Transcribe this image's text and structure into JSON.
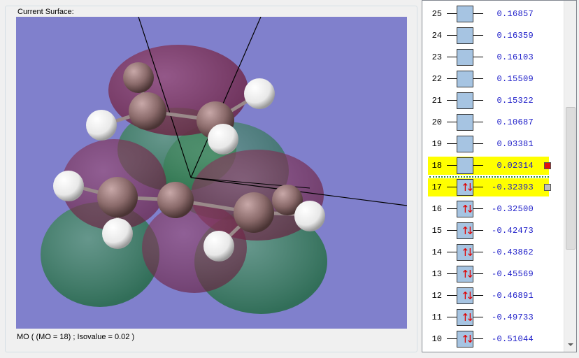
{
  "surface": {
    "group_title": "Current Surface:",
    "caption": "MO ( (MO = 18) ; Isovalue = 0.02 )"
  },
  "orbitals": [
    {
      "num": "25",
      "energy": "0.16857",
      "occupied": false,
      "highlighted": false
    },
    {
      "num": "24",
      "energy": "0.16359",
      "occupied": false,
      "highlighted": false
    },
    {
      "num": "23",
      "energy": "0.16103",
      "occupied": false,
      "highlighted": false
    },
    {
      "num": "22",
      "energy": "0.15509",
      "occupied": false,
      "highlighted": false
    },
    {
      "num": "21",
      "energy": "0.15322",
      "occupied": false,
      "highlighted": false
    },
    {
      "num": "20",
      "energy": "0.10687",
      "occupied": false,
      "highlighted": false
    },
    {
      "num": "19",
      "energy": "0.03381",
      "occupied": false,
      "highlighted": false
    },
    {
      "num": "18",
      "energy": "0.02314",
      "occupied": false,
      "highlighted": true,
      "marker_color": "#e01010"
    },
    {
      "num": "17",
      "energy": "-0.32393",
      "occupied": true,
      "highlighted": true,
      "marker_color": "#c0c0c0"
    },
    {
      "num": "16",
      "energy": "-0.32500",
      "occupied": true,
      "highlighted": false
    },
    {
      "num": "15",
      "energy": "-0.42473",
      "occupied": true,
      "highlighted": false
    },
    {
      "num": "14",
      "energy": "-0.43862",
      "occupied": true,
      "highlighted": false
    },
    {
      "num": "13",
      "energy": "-0.45569",
      "occupied": true,
      "highlighted": false
    },
    {
      "num": "12",
      "energy": "-0.46891",
      "occupied": true,
      "highlighted": false
    },
    {
      "num": "11",
      "energy": "-0.49733",
      "occupied": true,
      "highlighted": false
    },
    {
      "num": "10",
      "energy": "-0.51044",
      "occupied": true,
      "highlighted": false
    }
  ],
  "colors": {
    "background": "#8080cc",
    "positive_lobe": "#7a2a4a",
    "negative_lobe": "#2f7a4a",
    "highlight": "#ffff00",
    "energy_text": "#1b1bc8",
    "spin_arrow": "#e00000"
  },
  "icons": {
    "spin_up": "↑",
    "spin_down": "↓"
  }
}
